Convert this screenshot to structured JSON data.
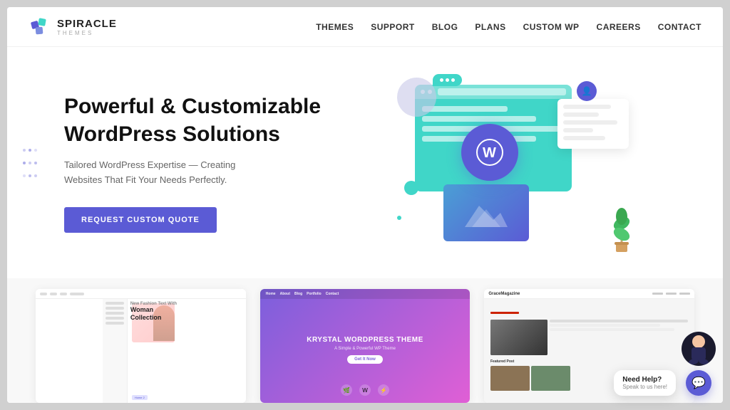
{
  "brand": {
    "name": "SPIRACLE",
    "tagline": "THEMES"
  },
  "nav": {
    "items": [
      {
        "label": "THEMES",
        "id": "themes"
      },
      {
        "label": "SUPPORT",
        "id": "support"
      },
      {
        "label": "BLOG",
        "id": "blog"
      },
      {
        "label": "PLANS",
        "id": "plans"
      },
      {
        "label": "CUSTOM WP",
        "id": "custom-wp"
      },
      {
        "label": "CAREERS",
        "id": "careers"
      },
      {
        "label": "CONTACT",
        "id": "contact"
      }
    ]
  },
  "hero": {
    "title_line1": "Powerful & Customizable",
    "title_line2": "WordPress Solutions",
    "subtitle": "Tailored WordPress Expertise — Creating Websites That Fit Your Needs Perfectly.",
    "cta_label": "REQUEST CUSTOM QUOTE"
  },
  "themes_preview": {
    "cards": [
      {
        "id": "omnishop",
        "label": "Home 2"
      },
      {
        "id": "krystal",
        "title": "KRYSTAL WORDPRESS THEME"
      },
      {
        "id": "grace-magazine",
        "name": "GraceMagazine",
        "featured": "Featured Post"
      }
    ]
  },
  "help_widget": {
    "title": "Need Help?",
    "subtitle": "Speak to us here!",
    "chat_icon": "💬"
  }
}
